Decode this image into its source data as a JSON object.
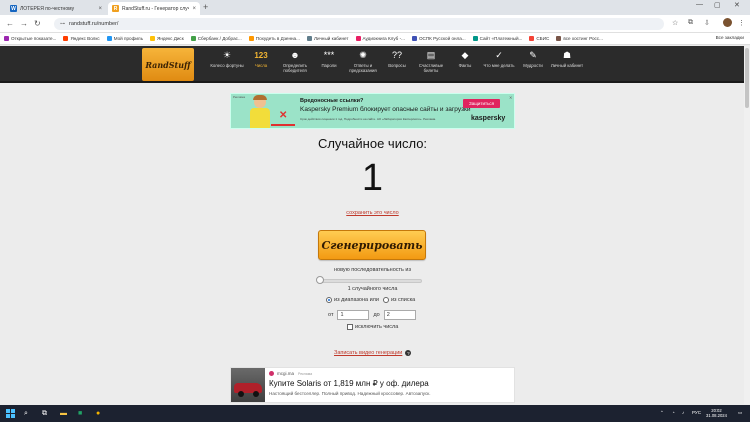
{
  "browser": {
    "tabs": [
      {
        "title": "ЛОТЕРЕЯ по-честному",
        "favicon_color": "#1565c0",
        "favicon_letter": "W"
      },
      {
        "title": "RandStuff.ru - Генератор случ...",
        "favicon_color": "#f0a020",
        "favicon_letter": "R"
      }
    ],
    "url": "randstuff.ru/number/",
    "bookmarks": [
      {
        "label": "Открытые показате...",
        "color": "#9c27b0"
      },
      {
        "label": "Яндекс Волкс",
        "color": "#ff3d00"
      },
      {
        "label": "Мой профиль",
        "color": "#2196f3"
      },
      {
        "label": "Яндекс Диск",
        "color": "#ffc107"
      },
      {
        "label": "Сбербанк / Добрас...",
        "color": "#43a047"
      },
      {
        "label": "Похудеть в Дзенна...",
        "color": "#ff9800"
      },
      {
        "label": "Личный кабинет",
        "color": "#607d8b"
      },
      {
        "label": "Аудиокнига Клуб -...",
        "color": "#e91e63"
      },
      {
        "label": "ОСПК Русской онла...",
        "color": "#3f51b5"
      },
      {
        "label": "Сайт «Платежный...",
        "color": "#009688"
      },
      {
        "label": "СБИС",
        "color": "#f44336"
      },
      {
        "label": "все хостинг Росс...",
        "color": "#795548"
      }
    ],
    "all_bookmarks": "Все закладки"
  },
  "site": {
    "logo": "RandStuff",
    "nav": [
      {
        "icon": "☀",
        "label": "Колесо фортуны",
        "active": false
      },
      {
        "icon": "123",
        "label": "Числа",
        "active": true
      },
      {
        "icon": "☻",
        "label": "Определить победителя",
        "active": false
      },
      {
        "icon": "***",
        "label": "Пароли",
        "active": false
      },
      {
        "icon": "✺",
        "label": "Ответы и предсказания",
        "active": false
      },
      {
        "icon": "??",
        "label": "Вопросы",
        "active": false
      },
      {
        "icon": "▤",
        "label": "Счастливые билеты",
        "active": false
      },
      {
        "icon": "◆",
        "label": "Факты",
        "active": false
      },
      {
        "icon": "✓",
        "label": "Что мне делать",
        "active": false
      },
      {
        "icon": "✎",
        "label": "Мудрости",
        "active": false
      },
      {
        "icon": "☗",
        "label": "Личный кабинет",
        "active": false
      }
    ]
  },
  "ad_banner": {
    "tag": "Реклама",
    "headline": "Вредоносные ссылки?",
    "sub": "Kaspersky Premium блокирует опасные сайты и загрузки",
    "fine_print": "Срок действия лицензии 1 год. Подробности на сайте. АО «Лаборатория Касперского». Реклама.",
    "button": "Защититься",
    "brand": "kaspersky"
  },
  "generator": {
    "title": "Случайное число:",
    "value": "1",
    "save_link": "сохранить это число",
    "generate_button": "Сгенерировать",
    "sequence_label": "новую последовательность из",
    "count_label": "1 случайного числа",
    "count_value": 1,
    "mode_range": "из диапазона или",
    "mode_list": "из списка",
    "from_label": "от",
    "from_value": "1",
    "to_label": "до",
    "to_value": "2",
    "exclude_label": "исключить числа",
    "video_link": "Записать видео генерации"
  },
  "ad2": {
    "source": "mcgi.ma",
    "source_tag": "Реклама",
    "headline": "Купите Solaris от 1,819 млн ₽ у оф. дилера",
    "desc": "Настоящий бестселлер. Полный привод. Надежный кроссовер. Автозапуск."
  },
  "taskbar": {
    "search": "⌕",
    "lang": "РУС",
    "time": "20:02",
    "date": "31.08.2024"
  }
}
